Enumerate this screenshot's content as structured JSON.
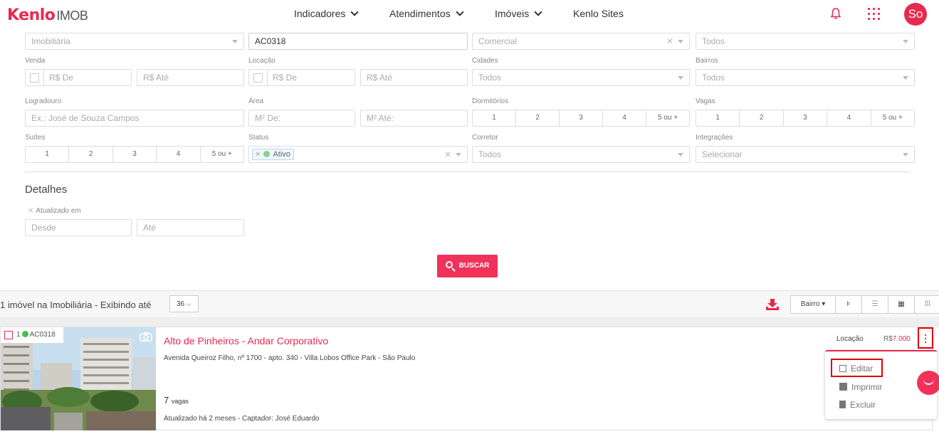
{
  "nav": {
    "logo_brand": "Kenlo",
    "logo_product": "IMOB",
    "items": [
      "Indicadores",
      "Atendimentos",
      "Imóveis",
      "Kenlo Sites"
    ],
    "avatar": "So",
    "colors": {
      "accent": "#e8294e"
    }
  },
  "filters": {
    "row1": {
      "imobiliaria": "Imobiliária",
      "codigo": "AC0318",
      "tipo": "Comercial",
      "todos": "Todos"
    },
    "venda": {
      "label": "Venda",
      "de": "R$ De",
      "ate": "R$ Até"
    },
    "locacao": {
      "label": "Locação",
      "de": "R$ De",
      "ate": "R$ Até"
    },
    "cidades": {
      "label": "Cidades",
      "placeholder": "Todos"
    },
    "bairros": {
      "label": "Bairros",
      "placeholder": "Todos"
    },
    "logradouro": {
      "label": "Logradouro",
      "placeholder": "Ex.: José de Souza Campos"
    },
    "area": {
      "label": "Área",
      "de": "M² De:",
      "ate": "M² Até:"
    },
    "dormitorios": {
      "label": "Dormitórios",
      "options": [
        "1",
        "2",
        "3",
        "4",
        "5 ou +"
      ]
    },
    "vagas": {
      "label": "Vagas",
      "options": [
        "1",
        "2",
        "3",
        "4",
        "5 ou +"
      ]
    },
    "suites": {
      "label": "Suítes",
      "options": [
        "1",
        "2",
        "3",
        "4",
        "5 ou +"
      ]
    },
    "status": {
      "label": "Status",
      "value": "Ativo"
    },
    "corretor": {
      "label": "Corretor",
      "placeholder": "Todos"
    },
    "integracoes": {
      "label": "Integrações",
      "placeholder": "Selecionar"
    }
  },
  "details": {
    "heading": "Detalhes",
    "updated_label": "Atualizado em",
    "desde": "Desde",
    "ate": "Até"
  },
  "search_button": "BUSCAR",
  "results": {
    "count_text": "1 imóvel na Imobiliária - Exibindo até",
    "per_page": "36",
    "sort": "Bairro",
    "view_icons": [
      "map-pin-icon",
      "list-icon",
      "table-icon",
      "grid-icon"
    ]
  },
  "listing": {
    "index": "1",
    "code": "AC0318",
    "title": "Alto de Pinheiros - Andar Corporativo",
    "address": "Avenida Queiroz Filho, nº 1700 - apto. 340 - Villa Lobos Office Park - São Paulo",
    "vagas_num": "7",
    "vagas_label": "vagas",
    "updated": "Atualizado há 2 meses - Captador: José Eduardo",
    "deal": "Locação",
    "price_prefix": "R$",
    "price": "7.000"
  },
  "menu": {
    "items": [
      "Editar",
      "Imprimir",
      "Excluir"
    ]
  }
}
